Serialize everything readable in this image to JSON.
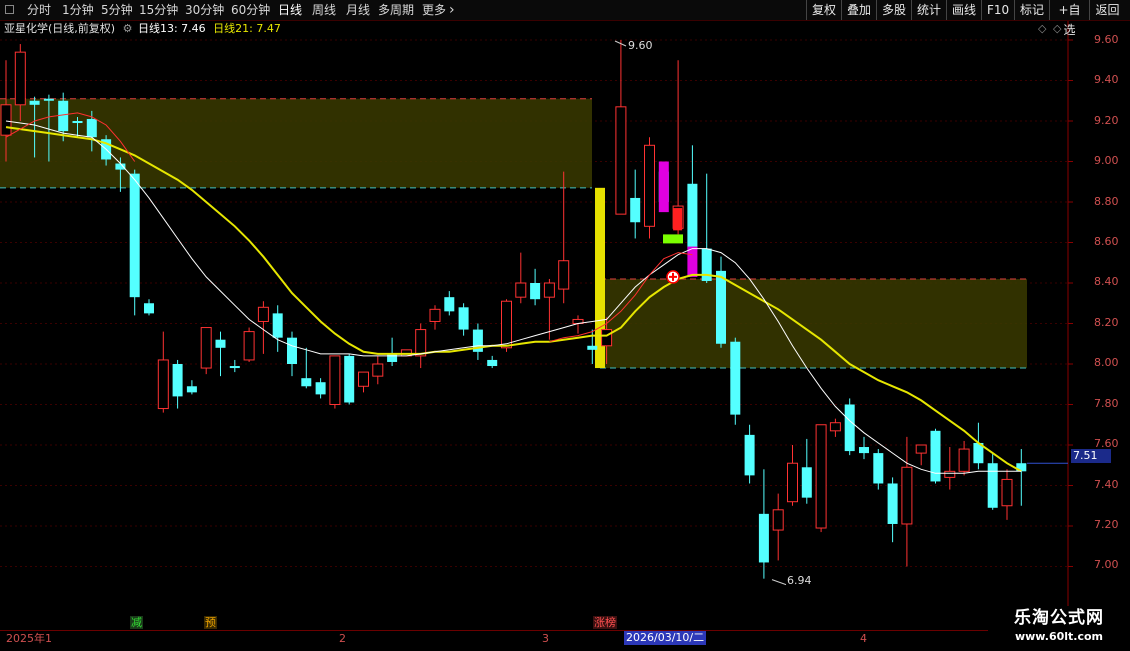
{
  "toolbar": {
    "periods": [
      "分时",
      "1分钟",
      "5分钟",
      "15分钟",
      "30分钟",
      "60分钟",
      "日线",
      "周线",
      "月线",
      "多周期",
      "更多"
    ],
    "active": "日线",
    "more_arrow": "›",
    "right_buttons": [
      "复权",
      "叠加",
      "多股",
      "统计",
      "画线",
      "F10",
      "标记",
      "+自选",
      "返回"
    ]
  },
  "info": {
    "stock": "亚星化学(日线,前复权)",
    "ma1_label": "日线13: 7.46",
    "ma2_label": "日线21: 7.47"
  },
  "price_axis": {
    "labels": [
      "9.60",
      "9.40",
      "9.20",
      "9.00",
      "8.80",
      "8.60",
      "8.40",
      "8.20",
      "8.00",
      "7.80",
      "7.60",
      "7.40",
      "7.20",
      "7.00"
    ],
    "current": "7.51"
  },
  "annotations": {
    "high": "9.60",
    "low": "6.94"
  },
  "markers": [
    {
      "text": "减",
      "color": "#33dd33"
    },
    {
      "text": "预",
      "color": "#e8a000"
    },
    {
      "text": "涨榜",
      "color": "#ff5050"
    }
  ],
  "time_axis": {
    "labels": [
      "2025年1",
      "2",
      "3",
      "4"
    ],
    "highlight": "2026/03/10/二"
  },
  "watermark": {
    "line1": "乐淘公式网",
    "line2": "www.60lt.com"
  },
  "colors": {
    "up": "#ff3232",
    "down": "#54ffff",
    "ma13": "#ffffff",
    "ma21": "#e6e600",
    "zone": "#3a3a00"
  },
  "chart_data": {
    "type": "candlestick",
    "ylim": [
      6.9,
      9.7
    ],
    "candles": [
      [
        9.13,
        9.5,
        9.28,
        9.0
      ],
      [
        9.28,
        9.58,
        9.54,
        9.2
      ],
      [
        9.3,
        9.32,
        9.28,
        9.02
      ],
      [
        9.31,
        9.33,
        9.3,
        9.0
      ],
      [
        9.3,
        9.34,
        9.15,
        9.1
      ],
      [
        9.2,
        9.22,
        9.19,
        9.12
      ],
      [
        9.21,
        9.25,
        9.12,
        9.05
      ],
      [
        9.11,
        9.13,
        9.01,
        8.98
      ],
      [
        8.99,
        9.02,
        8.96,
        8.85
      ],
      [
        8.94,
        8.96,
        8.33,
        8.24
      ],
      [
        8.3,
        8.32,
        8.25,
        8.24
      ],
      [
        7.78,
        8.16,
        8.02,
        7.76
      ],
      [
        8.0,
        8.02,
        7.84,
        7.78
      ],
      [
        7.89,
        7.92,
        7.86,
        7.85
      ],
      [
        7.98,
        8.18,
        8.18,
        7.95
      ],
      [
        8.12,
        8.16,
        8.08,
        7.94
      ],
      [
        7.99,
        8.02,
        7.98,
        7.96
      ],
      [
        8.02,
        8.18,
        8.16,
        8.01
      ],
      [
        8.21,
        8.31,
        8.28,
        8.05
      ],
      [
        8.25,
        8.29,
        8.13,
        8.06
      ],
      [
        8.13,
        8.16,
        8.0,
        7.94
      ],
      [
        7.93,
        8.08,
        7.89,
        7.88
      ],
      [
        7.91,
        7.93,
        7.85,
        7.83
      ],
      [
        7.8,
        8.03,
        8.04,
        7.78
      ],
      [
        8.04,
        8.05,
        7.81,
        7.8
      ],
      [
        7.89,
        7.95,
        7.96,
        7.86
      ],
      [
        7.94,
        8.04,
        8.0,
        7.9
      ],
      [
        8.05,
        8.13,
        8.01,
        7.99
      ],
      [
        8.04,
        8.02,
        8.07,
        8.02
      ],
      [
        8.04,
        8.2,
        8.17,
        7.98
      ],
      [
        8.21,
        8.29,
        8.27,
        8.17
      ],
      [
        8.33,
        8.36,
        8.26,
        8.24
      ],
      [
        8.28,
        8.3,
        8.17,
        8.14
      ],
      [
        8.17,
        8.2,
        8.06,
        8.02
      ],
      [
        8.02,
        8.04,
        7.99,
        7.98
      ],
      [
        8.08,
        8.32,
        8.31,
        8.06
      ],
      [
        8.33,
        8.55,
        8.4,
        8.3
      ],
      [
        8.4,
        8.47,
        8.32,
        8.29
      ],
      [
        8.33,
        8.42,
        8.4,
        8.12
      ],
      [
        8.37,
        8.95,
        8.51,
        8.3
      ],
      [
        8.2,
        8.24,
        8.22,
        8.15
      ],
      [
        8.09,
        8.17,
        8.07,
        8.0
      ],
      [
        8.09,
        8.23,
        8.17,
        8.0
      ],
      [
        8.74,
        9.6,
        9.27,
        8.98
      ],
      [
        8.82,
        8.96,
        8.7,
        8.62
      ],
      [
        8.68,
        9.12,
        9.08,
        8.62
      ],
      [
        8.95,
        8.97,
        8.8,
        8.78
      ],
      [
        8.67,
        9.5,
        8.78,
        8.64
      ],
      [
        8.89,
        9.08,
        8.57,
        8.58
      ],
      [
        8.57,
        8.94,
        8.41,
        8.4
      ],
      [
        8.46,
        8.53,
        8.1,
        8.08
      ],
      [
        8.11,
        8.13,
        7.75,
        7.7
      ],
      [
        7.65,
        7.7,
        7.45,
        7.41
      ],
      [
        7.26,
        7.48,
        7.02,
        6.94
      ],
      [
        7.18,
        7.36,
        7.28,
        7.03
      ],
      [
        7.32,
        7.6,
        7.51,
        7.3
      ],
      [
        7.49,
        7.63,
        7.34,
        7.31
      ],
      [
        7.19,
        7.7,
        7.7,
        7.17
      ],
      [
        7.67,
        7.73,
        7.71,
        7.64
      ],
      [
        7.8,
        7.83,
        7.57,
        7.55
      ],
      [
        7.59,
        7.64,
        7.56,
        7.53
      ],
      [
        7.56,
        7.58,
        7.41,
        7.38
      ],
      [
        7.41,
        7.44,
        7.21,
        7.12
      ],
      [
        7.21,
        7.64,
        7.49,
        7.0
      ],
      [
        7.56,
        7.6,
        7.6,
        7.5
      ],
      [
        7.67,
        7.68,
        7.42,
        7.41
      ],
      [
        7.44,
        7.59,
        7.47,
        7.38
      ],
      [
        7.47,
        7.62,
        7.58,
        7.45
      ],
      [
        7.61,
        7.71,
        7.51,
        7.48
      ],
      [
        7.51,
        7.56,
        7.29,
        7.28
      ],
      [
        7.3,
        7.48,
        7.43,
        7.23
      ],
      [
        7.51,
        7.58,
        7.47,
        7.3
      ]
    ],
    "ma13": [
      9.2,
      9.19,
      9.18,
      9.16,
      9.14,
      9.13,
      9.12,
      9.06,
      8.99,
      8.91,
      8.82,
      8.72,
      8.62,
      8.52,
      8.43,
      8.36,
      8.29,
      8.22,
      8.17,
      8.12,
      8.09,
      8.07,
      8.05,
      8.05,
      8.05,
      8.04,
      8.04,
      8.04,
      8.04,
      8.05,
      8.06,
      8.07,
      8.08,
      8.09,
      8.09,
      8.1,
      8.12,
      8.14,
      8.16,
      8.18,
      8.2,
      8.21,
      8.22,
      8.3,
      8.38,
      8.44,
      8.49,
      8.54,
      8.57,
      8.57,
      8.55,
      8.5,
      8.42,
      8.32,
      8.21,
      8.09,
      7.98,
      7.88,
      7.79,
      7.72,
      7.66,
      7.61,
      7.56,
      7.51,
      7.48,
      7.46,
      7.46,
      7.46,
      7.47,
      7.47,
      7.47,
      7.47
    ],
    "ma21": [
      9.17,
      9.16,
      9.15,
      9.14,
      9.13,
      9.12,
      9.11,
      9.09,
      9.06,
      9.03,
      8.99,
      8.95,
      8.91,
      8.86,
      8.8,
      8.74,
      8.68,
      8.61,
      8.53,
      8.44,
      8.35,
      8.28,
      8.21,
      8.15,
      8.1,
      8.06,
      8.05,
      8.05,
      8.05,
      8.05,
      8.06,
      8.06,
      8.07,
      8.08,
      8.09,
      8.09,
      8.1,
      8.11,
      8.11,
      8.12,
      8.13,
      8.14,
      8.14,
      8.18,
      8.26,
      8.33,
      8.38,
      8.42,
      8.44,
      8.44,
      8.43,
      8.39,
      8.35,
      8.31,
      8.27,
      8.22,
      8.17,
      8.12,
      8.06,
      8.0,
      7.96,
      7.92,
      7.89,
      7.86,
      7.82,
      7.77,
      7.72,
      7.67,
      7.61,
      7.56,
      7.51,
      7.47
    ]
  }
}
